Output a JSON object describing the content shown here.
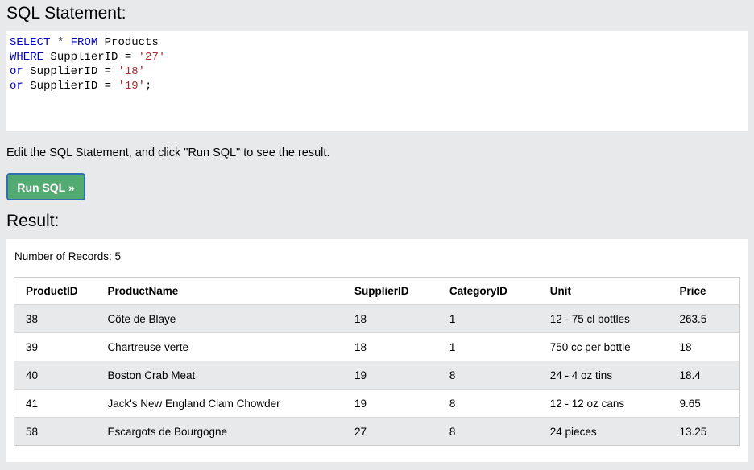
{
  "sql_section": {
    "heading": "SQL Statement:",
    "code_lines": [
      [
        {
          "t": "SELECT",
          "c": "kw"
        },
        {
          "t": " * ",
          "c": ""
        },
        {
          "t": "FROM",
          "c": "kw"
        },
        {
          "t": " Products",
          "c": ""
        }
      ],
      [
        {
          "t": "WHERE",
          "c": "kw"
        },
        {
          "t": " SupplierID = ",
          "c": ""
        },
        {
          "t": "'27'",
          "c": "str"
        }
      ],
      [
        {
          "t": "or",
          "c": "kw"
        },
        {
          "t": " SupplierID = ",
          "c": ""
        },
        {
          "t": "'18'",
          "c": "str"
        }
      ],
      [
        {
          "t": "or",
          "c": "kw"
        },
        {
          "t": " SupplierID = ",
          "c": ""
        },
        {
          "t": "'19'",
          "c": "str"
        },
        {
          "t": ";",
          "c": ""
        }
      ]
    ]
  },
  "instructions": "Edit the SQL Statement, and click \"Run SQL\" to see the result.",
  "run_button": {
    "label": "Run SQL »"
  },
  "result_section": {
    "heading": "Result:",
    "records_text": "Number of Records: 5",
    "columns": [
      "ProductID",
      "ProductName",
      "SupplierID",
      "CategoryID",
      "Unit",
      "Price"
    ],
    "rows": [
      [
        "38",
        "Côte de Blaye",
        "18",
        "1",
        "12 - 75 cl bottles",
        "263.5"
      ],
      [
        "39",
        "Chartreuse verte",
        "18",
        "1",
        "750 cc per bottle",
        "18"
      ],
      [
        "40",
        "Boston Crab Meat",
        "19",
        "8",
        "24 - 4 oz tins",
        "18.4"
      ],
      [
        "41",
        "Jack's New England Clam Chowder",
        "19",
        "8",
        "12 - 12 oz cans",
        "9.65"
      ],
      [
        "58",
        "Escargots de Bourgogne",
        "27",
        "8",
        "24 pieces",
        "13.25"
      ]
    ]
  },
  "colors": {
    "page_background": "#e7e9eb",
    "keyword": "#0000c8",
    "string": "#a52a2a",
    "button_green": "#52ac72",
    "button_border": "#2f6fb0"
  }
}
